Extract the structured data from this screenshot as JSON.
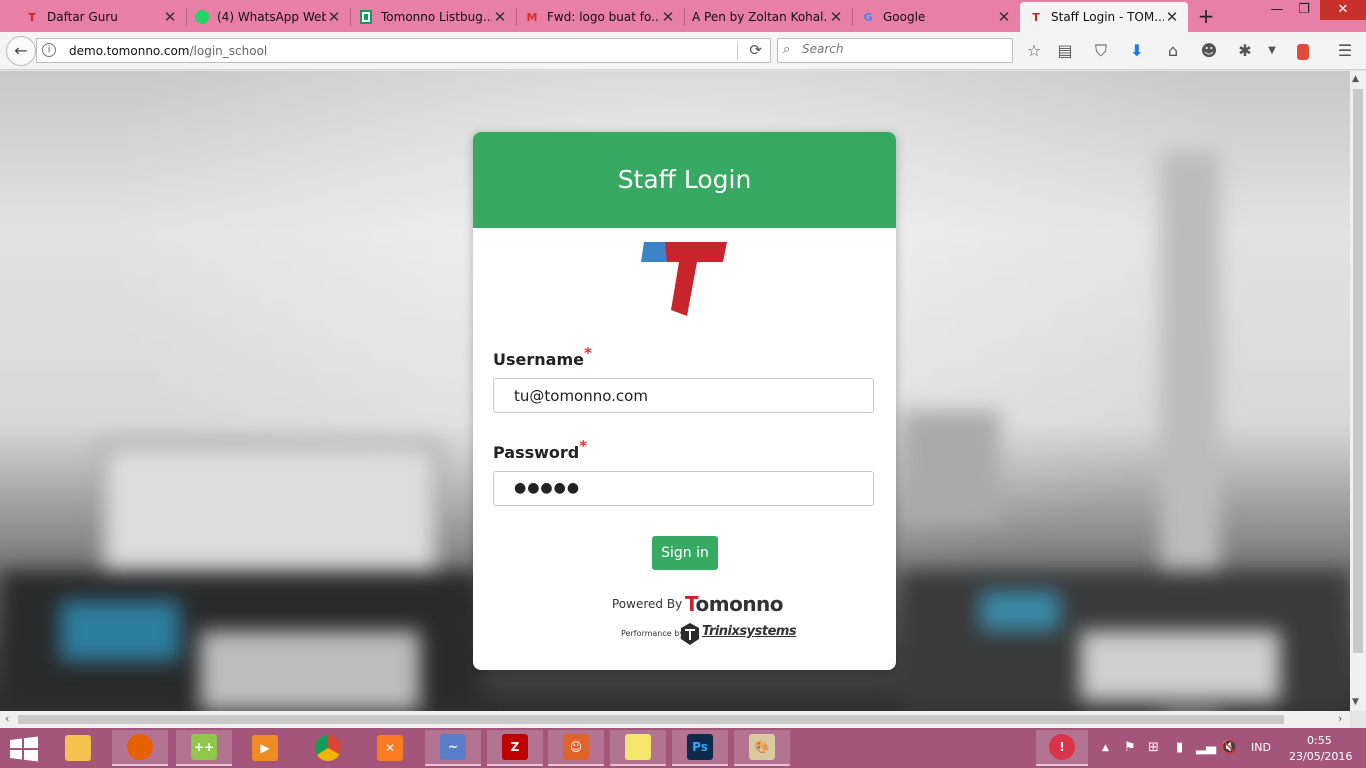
{
  "browser": {
    "tabs": [
      {
        "title": "Daftar Guru",
        "favicon": "tomonno-icon",
        "favicon_color": "#c8242b",
        "active": false
      },
      {
        "title": "(4) WhatsApp Web",
        "favicon": "whatsapp-icon",
        "favicon_color": "#25d366",
        "active": false
      },
      {
        "title": "Tomonno Listbug...",
        "favicon": "sheets-icon",
        "favicon_color": "#0f9d58",
        "active": false
      },
      {
        "title": "Fwd: logo buat fo...",
        "favicon": "gmail-icon",
        "favicon_color": "#d93025",
        "active": false
      },
      {
        "title": "A Pen by Zoltan Kohal...",
        "favicon": "codepen-icon",
        "favicon_color": "#000000",
        "active": false
      },
      {
        "title": "Google",
        "favicon": "google-icon",
        "favicon_color": "#4285f4",
        "active": false
      },
      {
        "title": "Staff Login - TOM...",
        "favicon": "tomonno-icon",
        "favicon_color": "#c8242b",
        "active": true
      }
    ],
    "new_tab_symbol": "+",
    "url_domain": "demo.tomonno.com",
    "url_path": "/login_school",
    "search_placeholder": "Search"
  },
  "login": {
    "header_title": "Staff Login",
    "username_label": "Username",
    "username_value": "tu@tomonno.com",
    "password_label": "Password",
    "password_masked": "●●●●●",
    "required_mark": "*",
    "signin_label": "Sign in",
    "powered_by_text": "Powered By",
    "brand_name_first": "T",
    "brand_name_rest": "omonno",
    "performance_text": "Performance by",
    "partner_name": "Trinixsystems"
  },
  "colors": {
    "accent_green": "#37a962",
    "brand_red": "#c8242b",
    "brand_blue": "#3c84c6",
    "tabbar_pink": "#e87fa4",
    "taskbar_mauve": "#a3567a"
  },
  "taskbar": {
    "apps": [
      "file-explorer-icon",
      "firefox-icon",
      "notepadpp-icon",
      "media-player-icon",
      "chrome-icon",
      "xampp-icon",
      "dolphin-icon",
      "filezilla-icon",
      "character-app-icon",
      "sticky-notes-icon",
      "photoshop-icon",
      "paint-icon"
    ],
    "language": "IND",
    "time": "0:55",
    "date": "23/05/2016"
  }
}
